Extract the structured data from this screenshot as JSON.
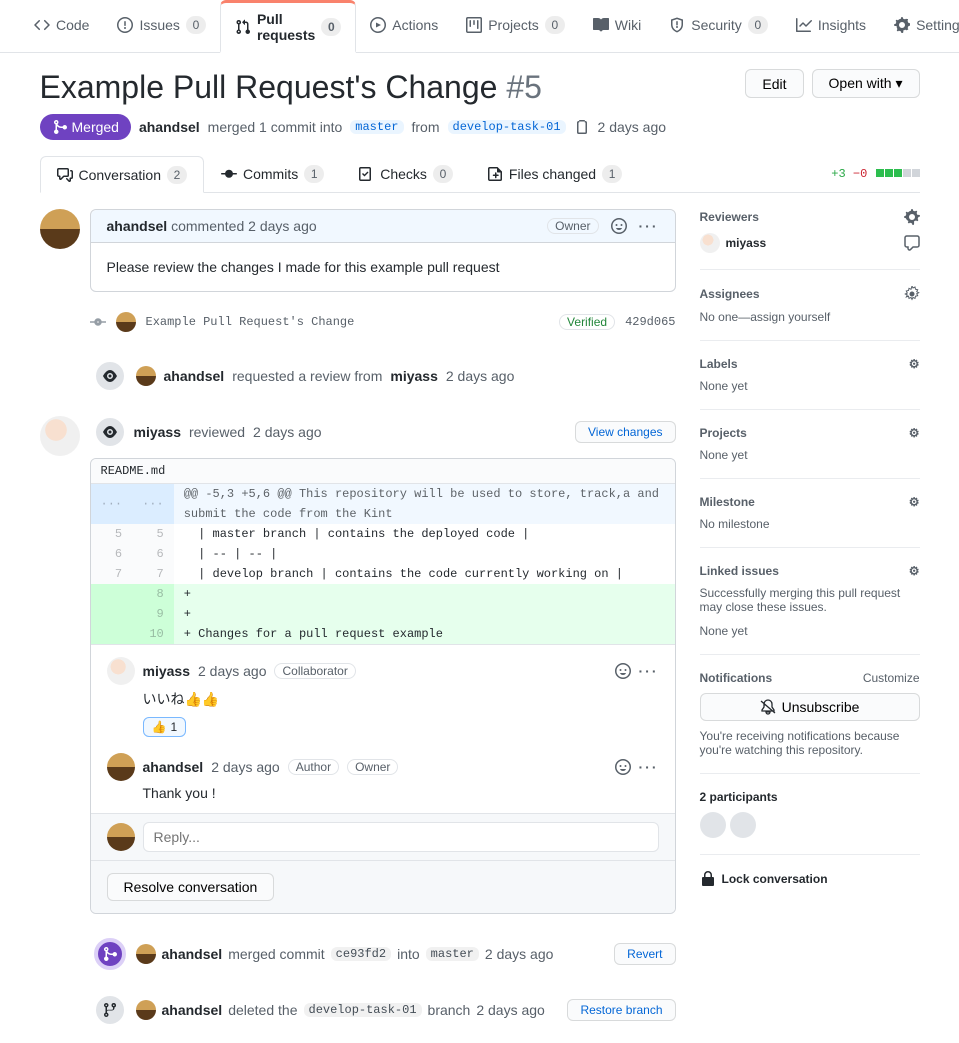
{
  "topnav": {
    "code": "Code",
    "issues": "Issues",
    "issues_count": "0",
    "pulls": "Pull requests",
    "pulls_count": "0",
    "actions": "Actions",
    "projects": "Projects",
    "projects_count": "0",
    "wiki": "Wiki",
    "security": "Security",
    "security_count": "0",
    "insights": "Insights",
    "settings": "Settings"
  },
  "title": "Example Pull Request's Change",
  "pr_number": "#5",
  "edit_btn": "Edit",
  "open_with_btn": "Open with",
  "state": "Merged",
  "merge_meta": {
    "author": "ahandsel",
    "text_merged": "merged 1 commit into",
    "base": "master",
    "from": "from",
    "head": "develop-task-01",
    "when": "2 days ago"
  },
  "pr_tabs": {
    "conversation": "Conversation",
    "conversation_count": "2",
    "commits": "Commits",
    "commits_count": "1",
    "checks": "Checks",
    "checks_count": "0",
    "files": "Files changed",
    "files_count": "1"
  },
  "diffstat": {
    "add": "+3",
    "del": "−0"
  },
  "comment": {
    "author": "ahandsel",
    "action": "commented",
    "when": "2 days ago",
    "owner_label": "Owner",
    "body": "Please review the changes I made for this example pull request"
  },
  "commit": {
    "message": "Example Pull Request's Change",
    "verified": "Verified",
    "sha": "429d065"
  },
  "review_request": {
    "author": "ahandsel",
    "text1": "requested a review from",
    "reviewer": "miyass",
    "when": "2 days ago"
  },
  "review": {
    "author": "miyass",
    "action": "reviewed",
    "when": "2 days ago",
    "view_changes": "View changes",
    "file": "README.md",
    "hunk": "@@ -5,3 +5,6 @@ This repository will be used to store, track,a and submit the code from the Kint",
    "lines": [
      {
        "old": "5",
        "new": "5",
        "type": "",
        "text": "  | master branch | contains the deployed code |"
      },
      {
        "old": "6",
        "new": "6",
        "type": "",
        "text": "  | -- | -- |"
      },
      {
        "old": "7",
        "new": "7",
        "type": "",
        "text": "  | develop branch | contains the code currently working on |"
      },
      {
        "old": "",
        "new": "8",
        "type": "add",
        "text": "+ "
      },
      {
        "old": "",
        "new": "9",
        "type": "add",
        "text": "+ "
      },
      {
        "old": "",
        "new": "10",
        "type": "add",
        "text": "+ Changes for a pull request example"
      }
    ],
    "inline1": {
      "author": "miyass",
      "when": "2 days ago",
      "badge": "Collaborator",
      "body": "いいね👍👍",
      "reaction_emoji": "👍",
      "reaction_count": "1"
    },
    "inline2": {
      "author": "ahandsel",
      "when": "2 days ago",
      "badge1": "Author",
      "badge2": "Owner",
      "body": "Thank you !"
    },
    "reply_placeholder": "Reply...",
    "resolve": "Resolve conversation"
  },
  "merged_event": {
    "author": "ahandsel",
    "text1": "merged commit",
    "sha": "ce93fd2",
    "text2": "into",
    "branch": "master",
    "when": "2 days ago",
    "revert": "Revert"
  },
  "deleted_event": {
    "author": "ahandsel",
    "text1": "deleted the",
    "branch": "develop-task-01",
    "text2": "branch",
    "when": "2 days ago",
    "restore": "Restore branch"
  },
  "sidebar": {
    "reviewers": {
      "title": "Reviewers",
      "name": "miyass"
    },
    "assignees": {
      "title": "Assignees",
      "text": "No one—assign yourself"
    },
    "labels": {
      "title": "Labels",
      "text": "None yet"
    },
    "projects": {
      "title": "Projects",
      "text": "None yet"
    },
    "milestone": {
      "title": "Milestone",
      "text": "No milestone"
    },
    "linked": {
      "title": "Linked issues",
      "desc": "Successfully merging this pull request may close these issues.",
      "text": "None yet"
    },
    "notifications": {
      "title": "Notifications",
      "customize": "Customize",
      "unsubscribe": "Unsubscribe",
      "desc": "You're receiving notifications because you're watching this repository."
    },
    "participants": {
      "title": "2 participants"
    },
    "lock": "Lock conversation"
  }
}
